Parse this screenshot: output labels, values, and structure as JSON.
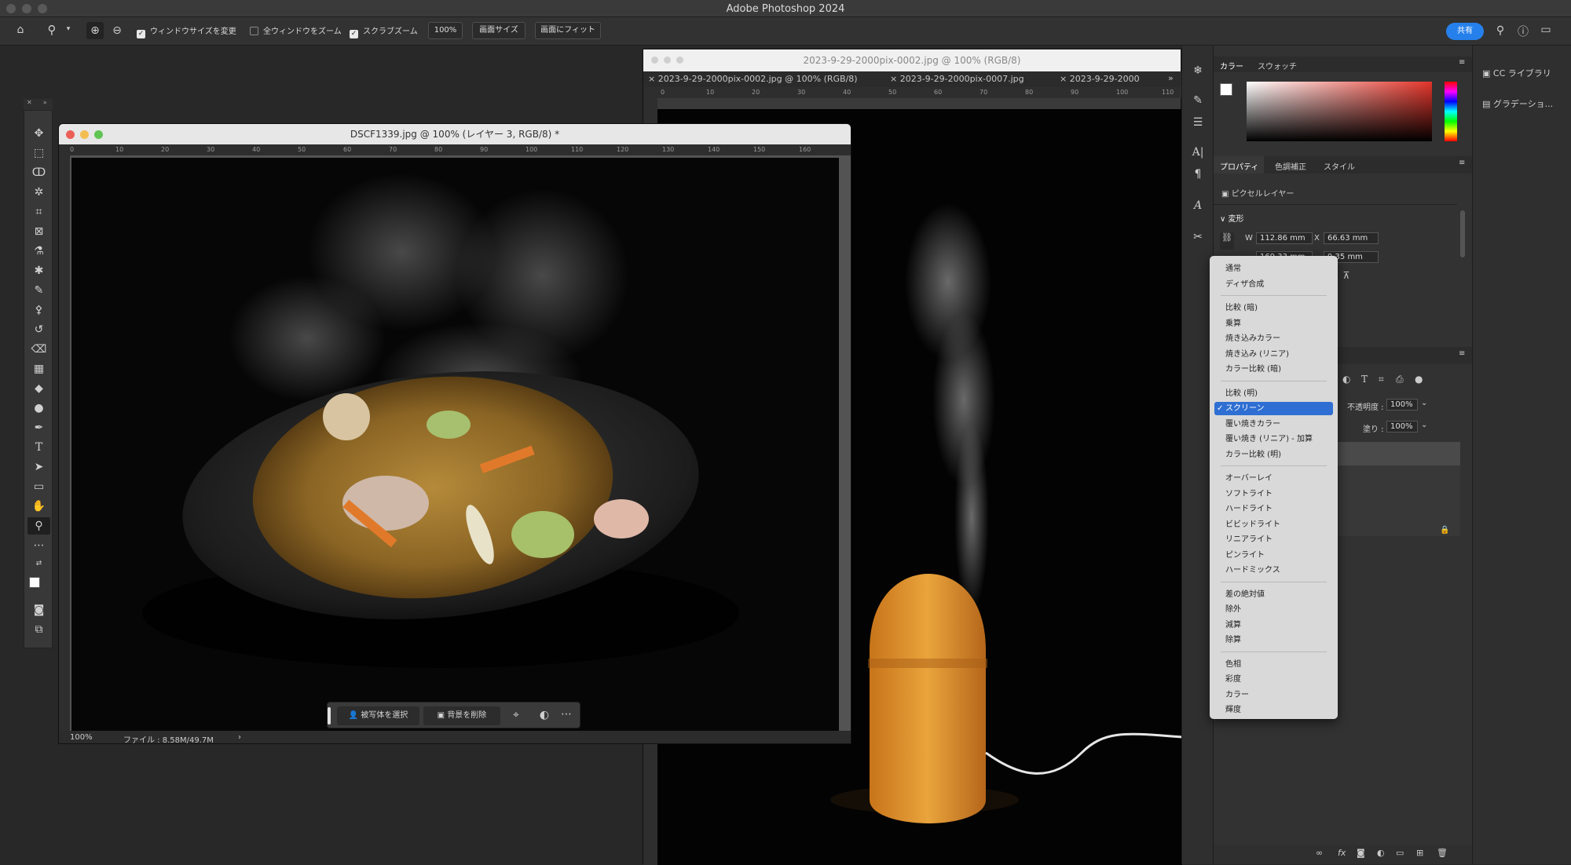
{
  "app": {
    "title": "Adobe Photoshop 2024"
  },
  "options_bar": {
    "resize_windows": "ウィンドウサイズを変更",
    "zoom_all_windows": "全ウィンドウをズーム",
    "scrubby_zoom": "スクラブズーム",
    "zoom_value": "100%",
    "fit_screen_size": "画面サイズ",
    "fill_screen": "画面にフィット",
    "share": "共有"
  },
  "doc1": {
    "title": "DSCF1339.jpg @ 100% (レイヤー 3, RGB/8) *",
    "ruler_h": [
      "0",
      "10",
      "20",
      "30",
      "40",
      "50",
      "60",
      "70",
      "80",
      "90",
      "100",
      "110",
      "120",
      "130",
      "140",
      "150",
      "160"
    ],
    "zoom": "100%",
    "file_info": "ファイル : 8.58M/49.7M",
    "taskbar": {
      "select_subject": "被写体を選択",
      "remove_bg": "背景を削除"
    }
  },
  "doc2": {
    "title": "2023-9-29-2000pix-0002.jpg @ 100% (RGB/8)",
    "tabs": [
      "2023-9-29-2000pix-0002.jpg @ 100% (RGB/8)",
      "2023-9-29-2000pix-0007.jpg",
      "2023-9-29-2000"
    ],
    "ruler_h": [
      "0",
      "10",
      "20",
      "30",
      "40",
      "50",
      "60",
      "70",
      "80",
      "90",
      "100",
      "110"
    ]
  },
  "color_panel": {
    "tabs": [
      "カラー",
      "スウォッチ"
    ]
  },
  "properties_panel": {
    "tabs": [
      "プロパティ",
      "色調補正",
      "スタイル"
    ],
    "layer_type": "ピクセルレイヤー",
    "section": "変形",
    "w_label": "W",
    "w_value": "112.86 mm",
    "x_label": "X",
    "x_value": "66.63 mm",
    "h_value": "169.33 mm",
    "y_value": "9.35 mm"
  },
  "layers_panel": {
    "opacity_label": "不透明度 :",
    "opacity_value": "100%",
    "fill_label": "塗り :",
    "fill_value": "100%"
  },
  "right_panels": {
    "libraries": "CC ライブラリ",
    "gradient": "グラデーショ..."
  },
  "blend_menu": {
    "groups": [
      [
        "通常",
        "ディザ合成"
      ],
      [
        "比較 (暗)",
        "乗算",
        "焼き込みカラー",
        "焼き込み (リニア)",
        "カラー比較 (暗)"
      ],
      [
        "比較 (明)",
        "スクリーン",
        "覆い焼きカラー",
        "覆い焼き (リニア) - 加算",
        "カラー比較 (明)"
      ],
      [
        "オーバーレイ",
        "ソフトライト",
        "ハードライト",
        "ビビッドライト",
        "リニアライト",
        "ピンライト",
        "ハードミックス"
      ],
      [
        "差の絶対値",
        "除外",
        "減算",
        "除算"
      ],
      [
        "色相",
        "彩度",
        "カラー",
        "輝度"
      ]
    ],
    "selected": "スクリーン"
  },
  "colors": {
    "accent": "#2680eb",
    "menu_selected": "#2f6fd3",
    "panel_bg": "#323232",
    "canvas_bg": "#282828"
  }
}
